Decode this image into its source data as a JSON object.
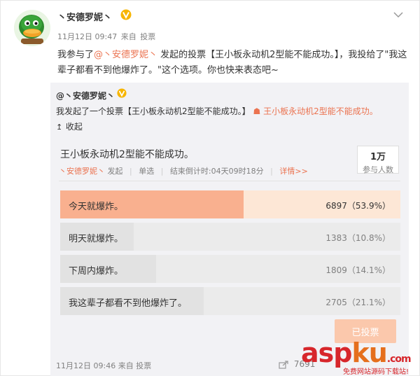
{
  "post": {
    "author": "丶安德罗妮丶",
    "date": "11月12日 09:47",
    "source_prefix": "来自",
    "source": "投票",
    "text_part1": "我参与了",
    "mention": "@丶安德罗妮丶",
    "text_part2": " 发起的投票【王小板永动机2型能不能成功。】，我投给了\"我这辈子都看不到他爆炸了。\"这个选项。你也快来表态吧~"
  },
  "repost": {
    "author": "@丶安德罗妮丶",
    "text_part1": "我发起了一个投票【王小板永动机2型能不能成功。】",
    "link_text": "王小板永动机2型能不能成功。",
    "collapse_label": "收起",
    "footer_date": "11月12日 09:46",
    "footer_source_prefix": "来自",
    "footer_source": "投票",
    "repost_count": "7691"
  },
  "poll": {
    "title": "王小板永动机2型能不能成功。",
    "creator": "丶安德罗妮丶",
    "creator_suffix": "发起",
    "type": "单选",
    "countdown": "结束倒计时:04天09时18分",
    "details_link": "详情>>",
    "participants_num": "1万",
    "participants_label": "参与人数",
    "options": [
      {
        "label": "今天就爆炸。",
        "stat": "6897（53.9%）",
        "percent": 53.9,
        "selected": true
      },
      {
        "label": "明天就爆炸。",
        "stat": "1383（10.8%）",
        "percent": 10.8,
        "selected": false
      },
      {
        "label": "下周内爆炸。",
        "stat": "1809（14.1%）",
        "percent": 14.1,
        "selected": false
      },
      {
        "label": "我这辈子都看不到他爆炸了。",
        "stat": "2705（21.1%）",
        "percent": 21.1,
        "selected": false
      }
    ],
    "voted_label": "已投票"
  },
  "watermark": {
    "main_a": "asp",
    "main_b": "ku",
    "main_c": ".com",
    "sub": "免费网站源码下载站!"
  },
  "colors": {
    "accent": "#eb7350",
    "selected_fill": "#f9b08f",
    "selected_bg": "#fde7d6",
    "vip_gold": "#f7b500"
  },
  "icons": [
    "duck-avatar-icon",
    "vip-badge-icon",
    "chevron-down-icon",
    "collapse-arrow-icon",
    "repost-icon"
  ]
}
